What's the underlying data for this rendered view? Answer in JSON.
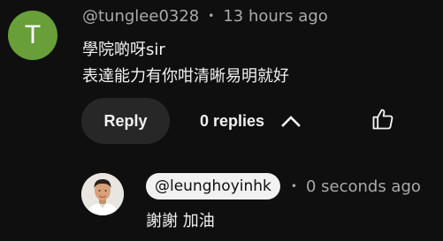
{
  "comment": {
    "avatar_letter": "T",
    "avatar_color": "#689f38",
    "author": "@tunglee0328",
    "separator": "•",
    "time": "13 hours ago",
    "text_lines": [
      "學院啲呀sir",
      "表達能力有你咁清晰易明就好"
    ],
    "actions": {
      "reply_label": "Reply",
      "replies_label": "0 replies",
      "chevron_icon": "chevron-up-icon",
      "like_icon": "thumbs-up-icon"
    }
  },
  "reply": {
    "avatar_icon": "user-photo-avatar",
    "mention": "@leunghoyinhk",
    "separator": "•",
    "time": "0 seconds ago",
    "text": "謝謝 加油"
  }
}
